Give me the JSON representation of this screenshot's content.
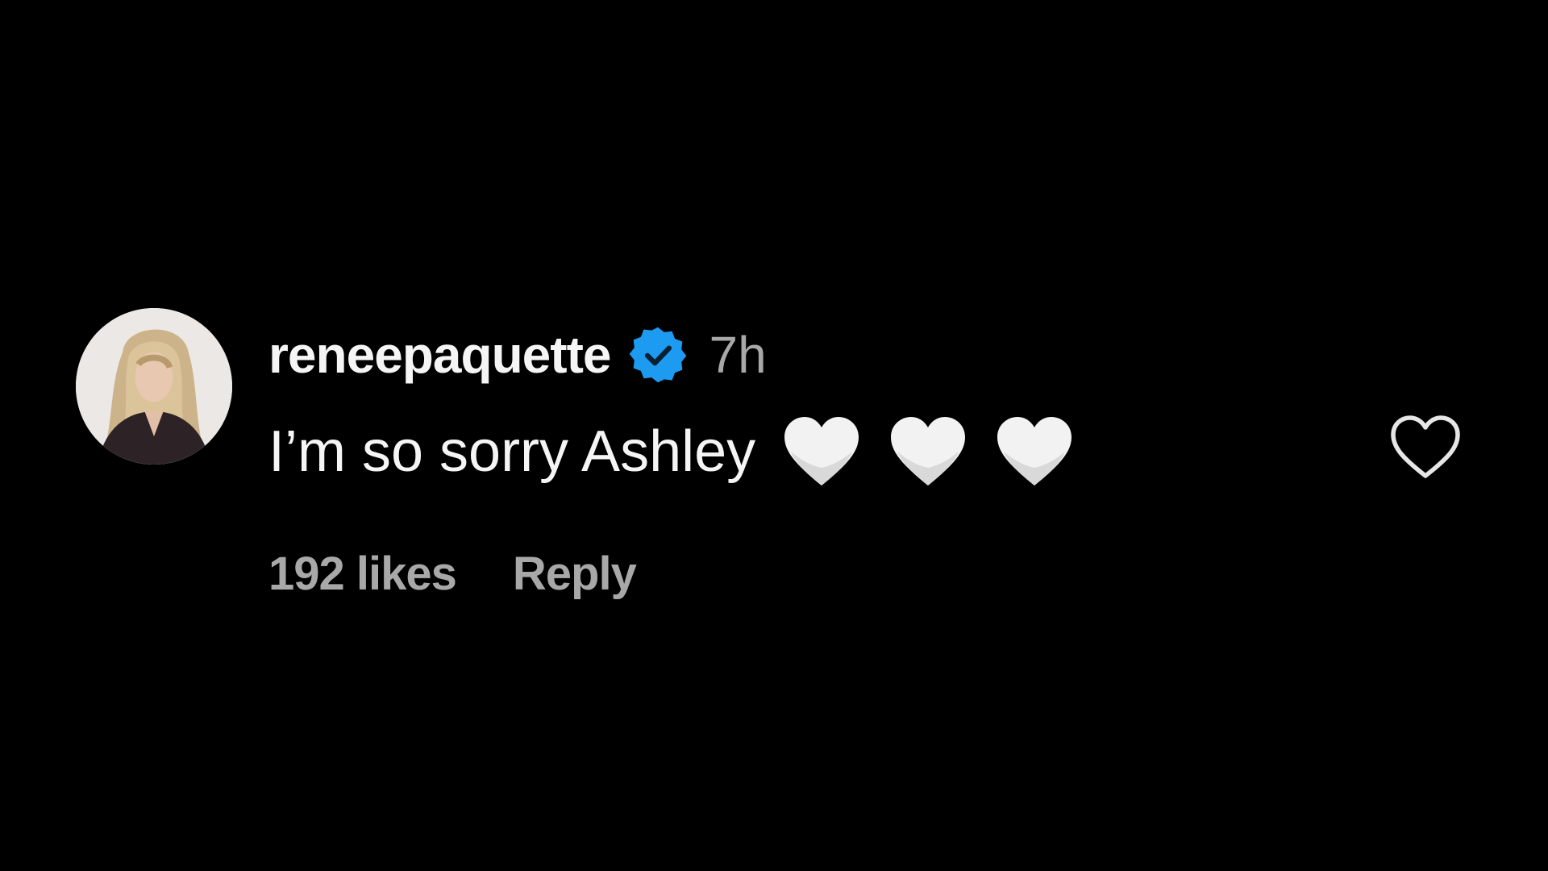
{
  "comment": {
    "username": "reneepaquette",
    "verified": true,
    "timestamp": "7h",
    "text": "I’m so sorry Ashley",
    "emoji": [
      "white-heart",
      "white-heart",
      "white-heart"
    ],
    "likes": "192 likes",
    "reply_label": "Reply",
    "like_icon": "heart-outline-icon"
  },
  "colors": {
    "background": "#000000",
    "primary_text": "#f5f5f5",
    "secondary_text": "#a8a8a8",
    "verified_badge": "#1d9bf0"
  }
}
